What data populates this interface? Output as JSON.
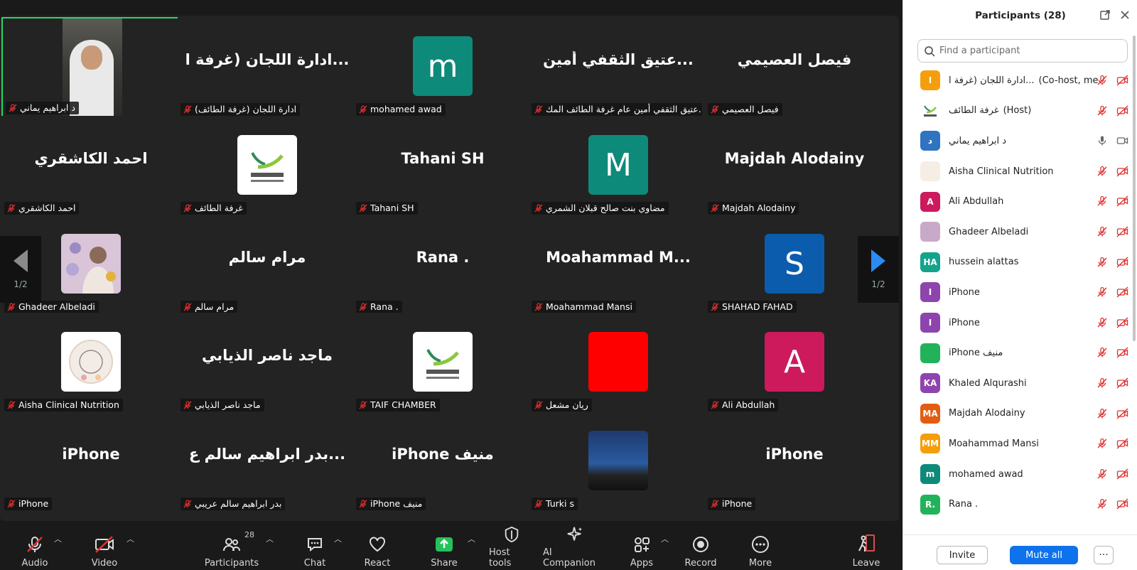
{
  "tiles": [
    {
      "display": "",
      "label": "د ابراهيم يماني",
      "type": "video",
      "active": true
    },
    {
      "display": "ادارة اللجان (غرفة ا...",
      "label": "ادارة اللجان (غرفة الطائف)",
      "type": "name"
    },
    {
      "display": "m",
      "label": "mohamed awad",
      "type": "avatar",
      "color": "#0e8a7a"
    },
    {
      "display": "عتيق الثقفي أمين...",
      "label": "عتيق الثقفي أمين عام غرفة الطائف المك...",
      "type": "name"
    },
    {
      "display": "فيصل العصيمي",
      "label": "فيصل العصيمي",
      "type": "name"
    },
    {
      "display": "احمد الكاشقري",
      "label": "احمد الكاشقري",
      "type": "name"
    },
    {
      "display": "",
      "label": "غرفة الطائف",
      "type": "logo"
    },
    {
      "display": "Tahani SH",
      "label": "Tahani SH",
      "type": "name"
    },
    {
      "display": "M",
      "label": "مضاوي بنت صالح قبلان الشمري",
      "type": "avatar",
      "color": "#0e8a7a"
    },
    {
      "display": "Majdah Alodainy",
      "label": "Majdah Alodainy",
      "type": "name"
    },
    {
      "display": "",
      "label": "Ghadeer Albeladi",
      "type": "art"
    },
    {
      "display": "مرام سالم",
      "label": "مرام سالم",
      "type": "name"
    },
    {
      "display": "Rana .",
      "label": "Rana .",
      "type": "name"
    },
    {
      "display": "Moahammad M...",
      "label": "Moahammad Mansi",
      "type": "name"
    },
    {
      "display": "S",
      "label": "SHAHAD FAHAD",
      "type": "avatar",
      "color": "#0b5cad"
    },
    {
      "display": "",
      "label": "Aisha Clinical Nutrition",
      "type": "aisha"
    },
    {
      "display": "ماجد ناصر الذيابي",
      "label": "ماجد ناصر الذيابي",
      "type": "name"
    },
    {
      "display": "",
      "label": "TAIF CHAMBER",
      "type": "logo"
    },
    {
      "display": "",
      "label": "ريان مشعل",
      "type": "avatar",
      "color": "#ff0000"
    },
    {
      "display": "A",
      "label": "Ali Abdullah",
      "type": "avatar",
      "color": "#cc1a5c"
    },
    {
      "display": "iPhone",
      "label": "iPhone",
      "type": "name"
    },
    {
      "display": "بدر ابراهيم سالم ع...",
      "label": "بدر ابراهيم سالم عريبي",
      "type": "name"
    },
    {
      "display": "iPhone منيف",
      "label": "iPhone منيف",
      "type": "name"
    },
    {
      "display": "",
      "label": "Turki s",
      "type": "sky"
    },
    {
      "display": "iPhone",
      "label": "iPhone",
      "type": "name"
    }
  ],
  "nav": {
    "page_left": "1/2",
    "page_right": "1/2"
  },
  "toolbar": {
    "audio": "Audio",
    "video": "Video",
    "participants": "Participants",
    "participants_count": "28",
    "chat": "Chat",
    "react": "React",
    "share": "Share",
    "host_tools": "Host tools",
    "ai_companion": "AI Companion",
    "apps": "Apps",
    "record": "Record",
    "more": "More",
    "leave": "Leave"
  },
  "panel": {
    "title": "Participants (28)",
    "search_placeholder": "Find a participant",
    "invite": "Invite",
    "mute_all": "Mute all",
    "more": "···"
  },
  "participants": [
    {
      "name": "ادارة اللجان (غرفة ا...",
      "role": "(Co-host, me)",
      "initial": "I",
      "color": "#f59e0b",
      "mic": "muted",
      "cam": "off"
    },
    {
      "name": "غرفة الطائف",
      "role": "(Host)",
      "initial": "",
      "color": "#ffffff",
      "mic": "muted",
      "cam": "off",
      "logo": true
    },
    {
      "name": "د ابراهيم يماني",
      "role": "",
      "initial": "د",
      "color": "#2f74c0",
      "mic": "on",
      "cam": "on"
    },
    {
      "name": "Aisha Clinical Nutrition",
      "role": "",
      "initial": "",
      "color": "#f6ede4",
      "mic": "muted",
      "cam": "off"
    },
    {
      "name": "Ali Abdullah",
      "role": "",
      "initial": "A",
      "color": "#cc1a5c",
      "mic": "muted",
      "cam": "off"
    },
    {
      "name": "Ghadeer Albeladi",
      "role": "",
      "initial": "",
      "color": "#c9a9c8",
      "mic": "muted",
      "cam": "off"
    },
    {
      "name": "hussein alattas",
      "role": "",
      "initial": "HA",
      "color": "#14a38b",
      "mic": "muted",
      "cam": "off"
    },
    {
      "name": "iPhone",
      "role": "",
      "initial": "I",
      "color": "#8e44ad",
      "mic": "muted",
      "cam": "off"
    },
    {
      "name": "iPhone",
      "role": "",
      "initial": "I",
      "color": "#8e44ad",
      "mic": "muted",
      "cam": "off"
    },
    {
      "name": "iPhone منيف",
      "role": "",
      "initial": "",
      "color": "#22b35a",
      "mic": "muted",
      "cam": "off"
    },
    {
      "name": "Khaled Alqurashi",
      "role": "",
      "initial": "KA",
      "color": "#8e44ad",
      "mic": "muted",
      "cam": "off"
    },
    {
      "name": "Majdah Alodainy",
      "role": "",
      "initial": "MA",
      "color": "#e25d10",
      "mic": "muted",
      "cam": "off"
    },
    {
      "name": "Moahammad Mansi",
      "role": "",
      "initial": "MM",
      "color": "#f59e0b",
      "mic": "muted",
      "cam": "off"
    },
    {
      "name": "mohamed awad",
      "role": "",
      "initial": "m",
      "color": "#0e8a7a",
      "mic": "muted",
      "cam": "off"
    },
    {
      "name": "Rana .",
      "role": "",
      "initial": "R.",
      "color": "#22b35a",
      "mic": "muted",
      "cam": "off"
    }
  ],
  "colors": {
    "accent": "#0e72ed",
    "active_border": "#23d96a",
    "muted_red": "#e03030"
  }
}
